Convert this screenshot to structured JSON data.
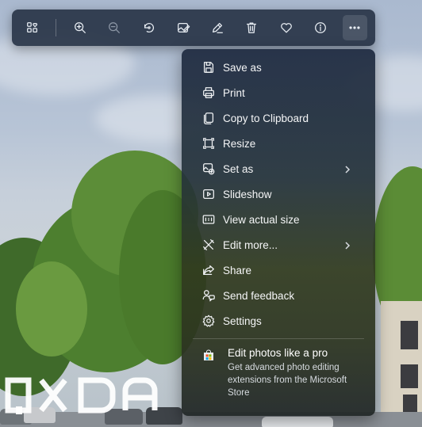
{
  "toolbar": {
    "buttons": [
      {
        "name": "add-to-album",
        "icon": "album-heart-icon"
      },
      {
        "name": "zoom-in",
        "icon": "zoom-in-icon"
      },
      {
        "name": "zoom-out",
        "icon": "zoom-out-icon"
      },
      {
        "name": "rotate",
        "icon": "rotate-icon"
      },
      {
        "name": "edit-image",
        "icon": "edit-image-icon"
      },
      {
        "name": "draw",
        "icon": "pen-icon"
      },
      {
        "name": "delete",
        "icon": "trash-icon"
      },
      {
        "name": "favorite",
        "icon": "heart-icon"
      },
      {
        "name": "file-info",
        "icon": "info-icon"
      },
      {
        "name": "see-more",
        "icon": "more-icon"
      }
    ]
  },
  "menu": {
    "items": [
      {
        "label": "Save as",
        "icon": "save-icon"
      },
      {
        "label": "Print",
        "icon": "print-icon"
      },
      {
        "label": "Copy to Clipboard",
        "icon": "copy-icon"
      },
      {
        "label": "Resize",
        "icon": "resize-icon"
      },
      {
        "label": "Set as",
        "icon": "set-as-icon",
        "submenu": true
      },
      {
        "label": "Slideshow",
        "icon": "slideshow-icon"
      },
      {
        "label": "View actual size",
        "icon": "actual-size-icon"
      },
      {
        "label": "Edit more...",
        "icon": "edit-more-icon",
        "submenu": true
      },
      {
        "label": "Share",
        "icon": "share-icon"
      },
      {
        "label": "Send feedback",
        "icon": "feedback-icon"
      },
      {
        "label": "Settings",
        "icon": "settings-icon"
      }
    ],
    "promo": {
      "title": "Edit photos like a pro",
      "description": "Get advanced photo editing extensions from the Microsoft Store",
      "icon": "microsoft-store-icon"
    }
  },
  "watermark": {
    "text": "XDA"
  },
  "colors": {
    "toolbar_bg": "#283446",
    "menu_top": "#202c42",
    "menu_mid": "#303a1e",
    "text": "#f5f6f7"
  }
}
